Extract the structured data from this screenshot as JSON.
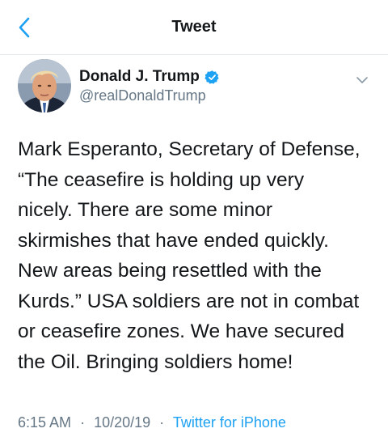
{
  "header": {
    "title": "Tweet",
    "back_icon": "chevron-left-icon",
    "accent_color": "#1da1f2"
  },
  "tweet": {
    "author_name": "Donald J. Trump",
    "author_handle": "@realDonaldTrump",
    "verified_icon": "verified-badge-icon",
    "menu_icon": "chevron-down-icon",
    "text": "Mark Esperanto, Secretary of Defense,\n“The ceasefire is holding up very\nnicely. There are some minor\nskirmishes that have ended quickly.\nNew areas being resettled with the\nKurds.” USA soldiers are not in combat\nor ceasefire zones. We have secured\nthe Oil. Bringing soldiers home!",
    "time": "6:15 AM",
    "separator": "·",
    "date": "10/20/19",
    "source": "Twitter for iPhone"
  }
}
